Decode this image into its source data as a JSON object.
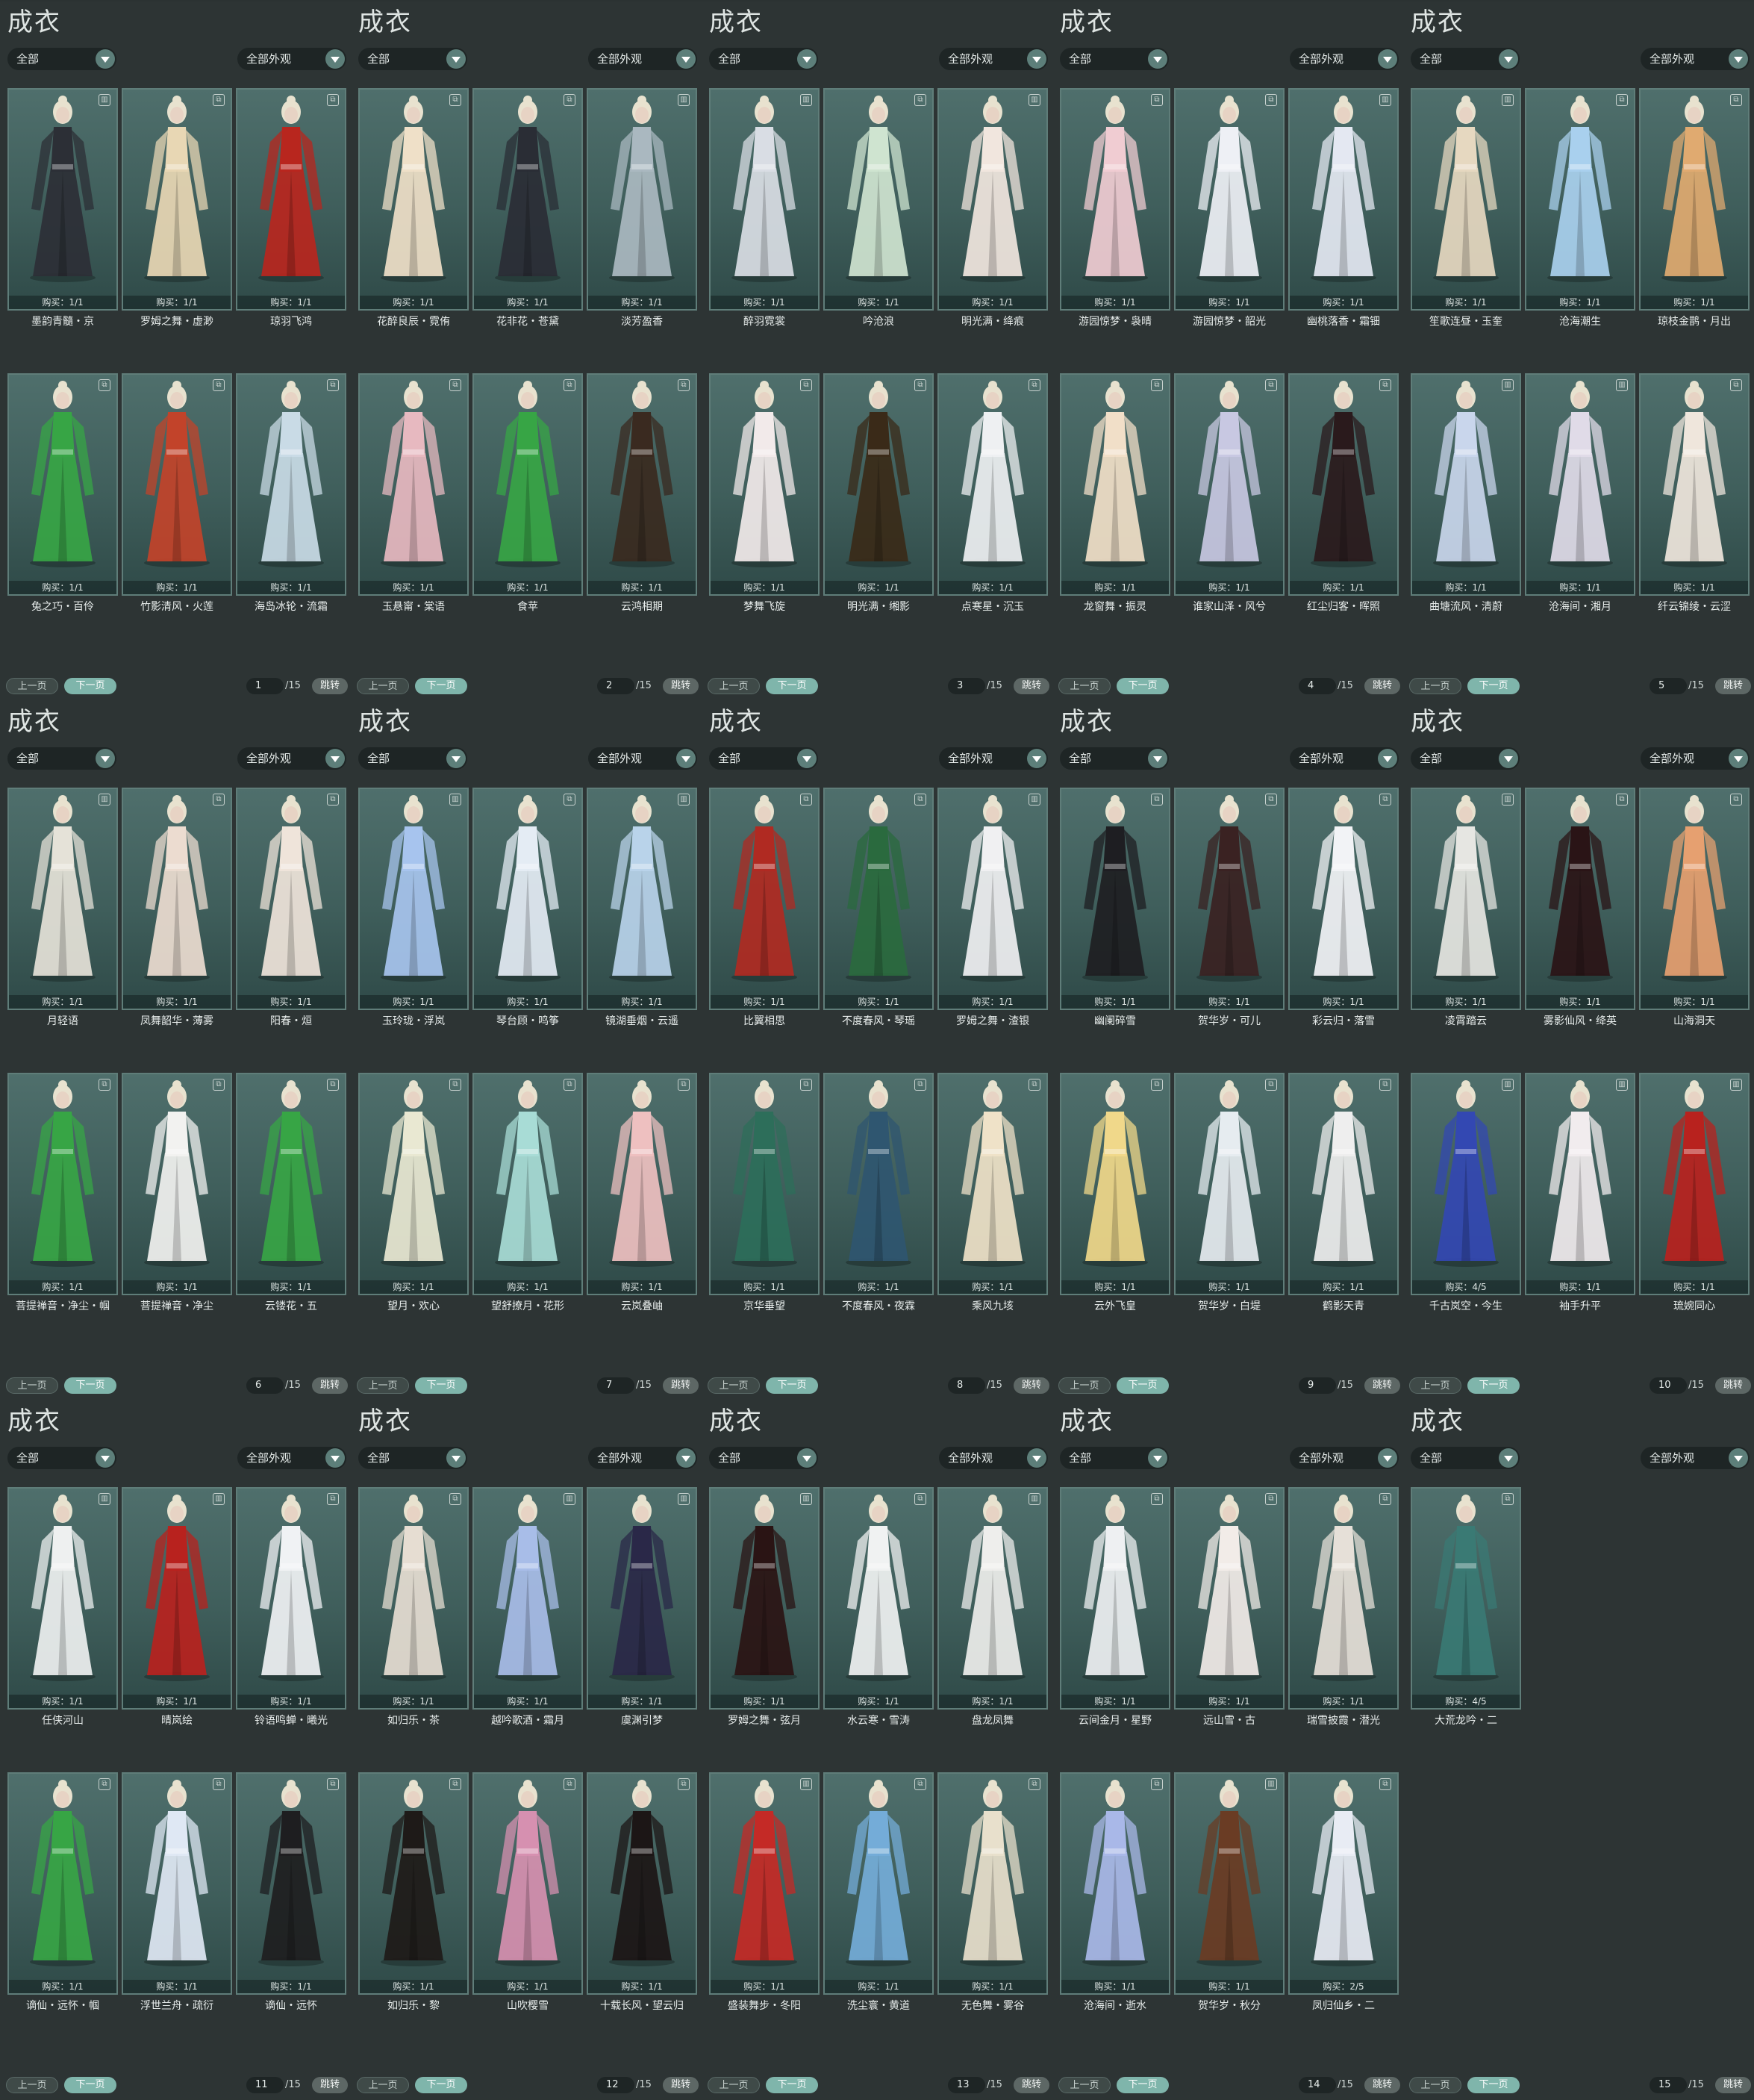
{
  "panels": [
    {
      "title": "成衣",
      "filter1": "全部",
      "filter2": "全部外观",
      "prev": "上一页",
      "next": "下一页",
      "page": "1",
      "total": "/15",
      "jump": "跳转",
      "items": [
        {
          "name": "墨韵青髓・京",
          "buy": "购买：1/1",
          "icon": "trash-icon",
          "dress": "#2c2f36"
        },
        {
          "name": "罗姆之舞・虚渺",
          "buy": "购买：1/1",
          "icon": "copy-icon",
          "dress": "#e8d7b4"
        },
        {
          "name": "琼羽飞鸿",
          "buy": "购买：1/1",
          "icon": "copy-icon",
          "dress": "#b8261e"
        },
        {
          "name": "兔之巧・百伶",
          "buy": "购买：1/1",
          "icon": "copy-icon",
          "dress": "#37a545"
        },
        {
          "name": "竹影清风・火莲",
          "buy": "购买：1/1",
          "icon": "copy-icon",
          "dress": "#c2432a"
        },
        {
          "name": "海岛冰轮・流霜",
          "buy": "购买：1/1",
          "icon": "copy-icon",
          "dress": "#c9dbe6"
        }
      ]
    },
    {
      "title": "成衣",
      "filter1": "全部",
      "filter2": "全部外观",
      "prev": "上一页",
      "next": "下一页",
      "page": "2",
      "total": "/15",
      "jump": "跳转",
      "items": [
        {
          "name": "花醉良辰・霓侑",
          "buy": "购买：1/1",
          "icon": "copy-icon",
          "dress": "#efe0c8"
        },
        {
          "name": "花非花・苍黛",
          "buy": "购买：1/1",
          "icon": "copy-icon",
          "dress": "#2a2d35"
        },
        {
          "name": "淡芳盈香",
          "buy": "购买：1/1",
          "icon": "trash-icon",
          "dress": "#aab8c0"
        },
        {
          "name": "玉悬甯・棠语",
          "buy": "购买：1/1",
          "icon": "copy-icon",
          "dress": "#e7b9c0"
        },
        {
          "name": "食苹",
          "buy": "购买：1/1",
          "icon": "copy-icon",
          "dress": "#37a545"
        },
        {
          "name": "云鸿相期",
          "buy": "购买：1/1",
          "icon": "copy-icon",
          "dress": "#3a2a20"
        }
      ]
    },
    {
      "title": "成衣",
      "filter1": "全部",
      "filter2": "全部外观",
      "prev": "上一页",
      "next": "下一页",
      "page": "3",
      "total": "/15",
      "jump": "跳转",
      "items": [
        {
          "name": "醉羽霓裳",
          "buy": "购买：1/1",
          "icon": "trash-icon",
          "dress": "#d9dde4"
        },
        {
          "name": "吟沧浪",
          "buy": "购买：1/1",
          "icon": "copy-icon",
          "dress": "#cfe4d0"
        },
        {
          "name": "明光满・绛痕",
          "buy": "购买：1/1",
          "icon": "trash-icon",
          "dress": "#f1e6de"
        },
        {
          "name": "梦舞飞旋",
          "buy": "购买：1/1",
          "icon": "copy-icon",
          "dress": "#f2eaea"
        },
        {
          "name": "明光满・缃影",
          "buy": "购买：1/1",
          "icon": "copy-icon",
          "dress": "#3a2a18"
        },
        {
          "name": "点寒星・沉玉",
          "buy": "购买：1/1",
          "icon": "copy-icon",
          "dress": "#eef0f2"
        }
      ]
    },
    {
      "title": "成衣",
      "filter1": "全部",
      "filter2": "全部外观",
      "prev": "上一页",
      "next": "下一页",
      "page": "4",
      "total": "/15",
      "jump": "跳转",
      "items": [
        {
          "name": "游园惊梦・袅晴",
          "buy": "购买：1/1",
          "icon": "copy-icon",
          "dress": "#f0ccd2"
        },
        {
          "name": "游园惊梦・韶光",
          "buy": "购买：1/1",
          "icon": "copy-icon",
          "dress": "#eef0f5"
        },
        {
          "name": "幽桃落香・霜钿",
          "buy": "购买：1/1",
          "icon": "trash-icon",
          "dress": "#e4e8f2"
        },
        {
          "name": "龙窗舞・振灵",
          "buy": "购买：1/1",
          "icon": "copy-icon",
          "dress": "#f1dfc8"
        },
        {
          "name": "谁家山泽・风兮",
          "buy": "购买：1/1",
          "icon": "copy-icon",
          "dress": "#c8c8e2"
        },
        {
          "name": "红尘归客・晖照",
          "buy": "购买：1/1",
          "icon": "copy-icon",
          "dress": "#2a1a1c"
        }
      ]
    },
    {
      "title": "成衣",
      "filter1": "全部",
      "filter2": "全部外观",
      "prev": "上一页",
      "next": "下一页",
      "page": "5",
      "total": "/15",
      "jump": "跳转",
      "items": [
        {
          "name": "笙歌连昼・玉奎",
          "buy": "购买：1/1",
          "icon": "trash-icon",
          "dress": "#e6d8c0"
        },
        {
          "name": "沧海潮生",
          "buy": "购买：1/1",
          "icon": "copy-icon",
          "dress": "#a9d0ee"
        },
        {
          "name": "琼枝金鹊・月出",
          "buy": "购买：1/1",
          "icon": "copy-icon",
          "dress": "#e0aa70"
        },
        {
          "name": "曲塘流风・清蔚",
          "buy": "购买：1/1",
          "icon": "trash-icon",
          "dress": "#c9d6ec"
        },
        {
          "name": "沧海间・湘月",
          "buy": "购买：1/1",
          "icon": "trash-icon",
          "dress": "#e0dbe8"
        },
        {
          "name": "纤云锦绫・云涩",
          "buy": "购买：1/1",
          "icon": "copy-icon",
          "dress": "#efe6dc"
        }
      ]
    },
    {
      "title": "成衣",
      "filter1": "全部",
      "filter2": "全部外观",
      "prev": "上一页",
      "next": "下一页",
      "page": "6",
      "total": "/15",
      "jump": "跳转",
      "items": [
        {
          "name": "月轻语",
          "buy": "购买：1/1",
          "icon": "trash-icon",
          "dress": "#e5e2d8"
        },
        {
          "name": "凤舞韶华・薄雾",
          "buy": "购买：1/1",
          "icon": "copy-icon",
          "dress": "#ecdcd0"
        },
        {
          "name": "阳春・烜",
          "buy": "购买：1/1",
          "icon": "copy-icon",
          "dress": "#efe4da"
        },
        {
          "name": "菩提禅音・净尘・帼",
          "buy": "购买：1/1",
          "icon": "copy-icon",
          "dress": "#37a545"
        },
        {
          "name": "菩提禅音・净尘",
          "buy": "购买：1/1",
          "icon": "copy-icon",
          "dress": "#f2f2f0"
        },
        {
          "name": "云镂花・五",
          "buy": "购买：1/1",
          "icon": "copy-icon",
          "dress": "#37a545"
        }
      ]
    },
    {
      "title": "成衣",
      "filter1": "全部",
      "filter2": "全部外观",
      "prev": "上一页",
      "next": "下一页",
      "page": "7",
      "total": "/15",
      "jump": "跳转",
      "items": [
        {
          "name": "玉玲珑・浮岚",
          "buy": "购买：1/1",
          "icon": "trash-icon",
          "dress": "#a7c4ee"
        },
        {
          "name": "琴台顾・鸣筝",
          "buy": "购买：1/1",
          "icon": "copy-icon",
          "dress": "#e4ecf4"
        },
        {
          "name": "镜湖垂烟・云遥",
          "buy": "购买：1/1",
          "icon": "trash-icon",
          "dress": "#b9d3ea"
        },
        {
          "name": "望月・欢心",
          "buy": "购买：1/1",
          "icon": "copy-icon",
          "dress": "#e9e8d2"
        },
        {
          "name": "望舒撩月・花形",
          "buy": "购买：1/1",
          "icon": "copy-icon",
          "dress": "#a8dcd6"
        },
        {
          "name": "云岚叠岫",
          "buy": "购买：1/1",
          "icon": "copy-icon",
          "dress": "#eec0c0"
        }
      ]
    },
    {
      "title": "成衣",
      "filter1": "全部",
      "filter2": "全部外观",
      "prev": "上一页",
      "next": "下一页",
      "page": "8",
      "total": "/15",
      "jump": "跳转",
      "items": [
        {
          "name": "比翼相思",
          "buy": "购买：1/1",
          "icon": "copy-icon",
          "dress": "#b02a22"
        },
        {
          "name": "不度春风・琴瑶",
          "buy": "购买：1/1",
          "icon": "copy-icon",
          "dress": "#2a6a3e"
        },
        {
          "name": "罗姆之舞・渣银",
          "buy": "购买：1/1",
          "icon": "trash-icon",
          "dress": "#f0f0f2"
        },
        {
          "name": "京华垂望",
          "buy": "购买：1/1",
          "icon": "copy-icon",
          "dress": "#2d6e5a"
        },
        {
          "name": "不度春风・夜霖",
          "buy": "购买：1/1",
          "icon": "copy-icon",
          "dress": "#2f5670"
        },
        {
          "name": "乘风九垓",
          "buy": "购买：1/1",
          "icon": "copy-icon",
          "dress": "#efe2c8"
        }
      ]
    },
    {
      "title": "成衣",
      "filter1": "全部",
      "filter2": "全部外观",
      "prev": "上一页",
      "next": "下一页",
      "page": "9",
      "total": "/15",
      "jump": "跳转",
      "items": [
        {
          "name": "幽阑碎雪",
          "buy": "购买：1/1",
          "icon": "copy-icon",
          "dress": "#1e1e22"
        },
        {
          "name": "贺华岁・可儿",
          "buy": "购买：1/1",
          "icon": "copy-icon",
          "dress": "#3a2222"
        },
        {
          "name": "彩云归・落雪",
          "buy": "购买：1/1",
          "icon": "copy-icon",
          "dress": "#f2f3f6"
        },
        {
          "name": "云外飞皇",
          "buy": "购买：1/1",
          "icon": "copy-icon",
          "dress": "#f0d88a"
        },
        {
          "name": "贺华岁・白堤",
          "buy": "购买：1/1",
          "icon": "copy-icon",
          "dress": "#e6ecf0"
        },
        {
          "name": "鹤影天青",
          "buy": "购买：1/1",
          "icon": "copy-icon",
          "dress": "#eeeeee"
        }
      ]
    },
    {
      "title": "成衣",
      "filter1": "全部",
      "filter2": "全部外观",
      "prev": "上一页",
      "next": "下一页",
      "page": "10",
      "total": "/15",
      "jump": "跳转",
      "items": [
        {
          "name": "凌霄踏云",
          "buy": "购买：1/1",
          "icon": "trash-icon",
          "dress": "#e6e6e2"
        },
        {
          "name": "雾影仙风・绛英",
          "buy": "购买：1/1",
          "icon": "copy-icon",
          "dress": "#2a1416"
        },
        {
          "name": "山海洞天",
          "buy": "购买：1/1",
          "icon": "copy-icon",
          "dress": "#e6a070"
        },
        {
          "name": "千古岚空・今生",
          "buy": "购买：4/5",
          "icon": "trash-icon",
          "dress": "#3348b2"
        },
        {
          "name": "袖手升平",
          "buy": "购买：1/1",
          "icon": "trash-icon",
          "dress": "#f1ecee"
        },
        {
          "name": "琉婉同心",
          "buy": "购买：1/1",
          "icon": "trash-icon",
          "dress": "#b8221e"
        }
      ]
    },
    {
      "title": "成衣",
      "filter1": "全部",
      "filter2": "全部外观",
      "prev": "上一页",
      "next": "下一页",
      "page": "11",
      "total": "/15",
      "jump": "跳转",
      "items": [
        {
          "name": "任侠河山",
          "buy": "购买：1/1",
          "icon": "trash-icon",
          "dress": "#eef0f0"
        },
        {
          "name": "晴岚绘",
          "buy": "购买：1/1",
          "icon": "trash-icon",
          "dress": "#b8221e"
        },
        {
          "name": "铃语鸣蝉・曦光",
          "buy": "购买：1/1",
          "icon": "copy-icon",
          "dress": "#f0f2f4"
        },
        {
          "name": "谪仙・远怀・帼",
          "buy": "购买：1/1",
          "icon": "copy-icon",
          "dress": "#37a545"
        },
        {
          "name": "浮世兰舟・疏衍",
          "buy": "购买：1/1",
          "icon": "copy-icon",
          "dress": "#dfe8f4"
        },
        {
          "name": "谪仙・远怀",
          "buy": "购买：1/1",
          "icon": "copy-icon",
          "dress": "#1e1e20"
        }
      ]
    },
    {
      "title": "成衣",
      "filter1": "全部",
      "filter2": "全部外观",
      "prev": "上一页",
      "next": "下一页",
      "page": "12",
      "total": "/15",
      "jump": "跳转",
      "items": [
        {
          "name": "如归乐・茶",
          "buy": "购买：1/1",
          "icon": "copy-icon",
          "dress": "#e6ddd2"
        },
        {
          "name": "越吟歌酒・霜月",
          "buy": "购买：1/1",
          "icon": "trash-icon",
          "dress": "#a8bde8"
        },
        {
          "name": "虞渊引梦",
          "buy": "购买：1/1",
          "icon": "trash-icon",
          "dress": "#2a2848"
        },
        {
          "name": "如归乐・黎",
          "buy": "购买：1/1",
          "icon": "copy-icon",
          "dress": "#1e1a18"
        },
        {
          "name": "山吹樱雪",
          "buy": "购买：1/1",
          "icon": "copy-icon",
          "dress": "#d690b0"
        },
        {
          "name": "十载长风・望云归",
          "buy": "购买：1/1",
          "icon": "copy-icon",
          "dress": "#1c1616"
        }
      ]
    },
    {
      "title": "成衣",
      "filter1": "全部",
      "filter2": "全部外观",
      "prev": "上一页",
      "next": "下一页",
      "page": "13",
      "total": "/15",
      "jump": "跳转",
      "items": [
        {
          "name": "罗姆之舞・弦月",
          "buy": "购买：1/1",
          "icon": "trash-icon",
          "dress": "#2a1414"
        },
        {
          "name": "水云寒・雪涛",
          "buy": "购买：1/1",
          "icon": "copy-icon",
          "dress": "#f0f2f2"
        },
        {
          "name": "盘龙凤舞",
          "buy": "购买：1/1",
          "icon": "trash-icon",
          "dress": "#eeeeec"
        },
        {
          "name": "盛装舞步・冬阳",
          "buy": "购买：1/1",
          "icon": "trash-icon",
          "dress": "#c42a26"
        },
        {
          "name": "洗尘寰・黄道",
          "buy": "购买：1/1",
          "icon": "copy-icon",
          "dress": "#74acd8"
        },
        {
          "name": "无色舞・雾谷",
          "buy": "购买：1/1",
          "icon": "copy-icon",
          "dress": "#e8e0cc"
        }
      ]
    },
    {
      "title": "成衣",
      "filter1": "全部",
      "filter2": "全部外观",
      "prev": "上一页",
      "next": "下一页",
      "page": "14",
      "total": "/15",
      "jump": "跳转",
      "items": [
        {
          "name": "云间金月・星野",
          "buy": "购买：1/1",
          "icon": "copy-icon",
          "dress": "#eef0f2"
        },
        {
          "name": "远山雪・古",
          "buy": "购买：1/1",
          "icon": "copy-icon",
          "dress": "#f2ece8"
        },
        {
          "name": "瑞雪披霞・潜光",
          "buy": "购买：1/1",
          "icon": "copy-icon",
          "dress": "#e6e0d8"
        },
        {
          "name": "沧海间・逝水",
          "buy": "购买：1/1",
          "icon": "copy-icon",
          "dress": "#a9b8e8"
        },
        {
          "name": "贺华岁・秋分",
          "buy": "购买：1/1",
          "icon": "trash-icon",
          "dress": "#6a3c24"
        },
        {
          "name": "凤归仙乡・二",
          "buy": "购买：2/5",
          "icon": "copy-icon",
          "dress": "#e8ecf4"
        }
      ]
    },
    {
      "title": "成衣",
      "filter1": "全部",
      "filter2": "全部外观",
      "prev": "上一页",
      "next": "下一页",
      "page": "15",
      "total": "/15",
      "jump": "跳转",
      "items": [
        {
          "name": "大荒龙吟・二",
          "buy": "购买：4/5",
          "icon": "copy-icon",
          "dress": "#3a7a74"
        }
      ]
    }
  ]
}
